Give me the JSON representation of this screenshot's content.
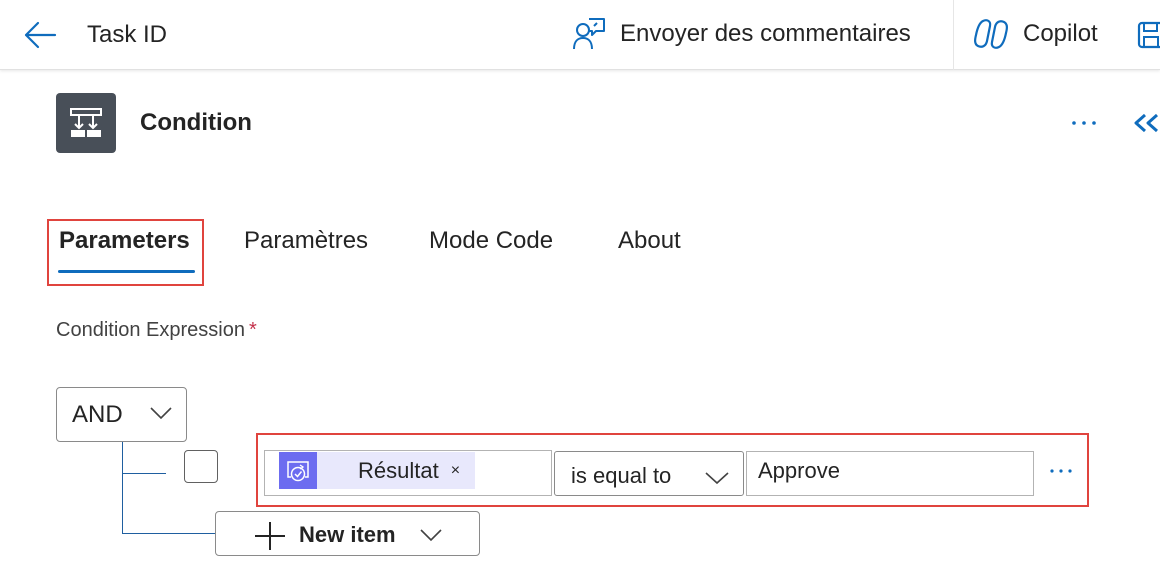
{
  "header": {
    "title": "Task ID",
    "back_icon": "arrow-left-icon",
    "feedback_label": "Envoyer des commentaires",
    "feedback_icon": "person-feedback-icon",
    "copilot_label": "Copilot",
    "copilot_icon": "copilot-icon",
    "save_icon": "save-icon"
  },
  "action": {
    "title": "Condition",
    "icon": "condition-icon",
    "more_icon": "more-horizontal-icon",
    "collapse_icon": "chevron-double-left-icon"
  },
  "tabs": [
    {
      "label": "Parameters",
      "active": true
    },
    {
      "label": "Paramètres",
      "active": false
    },
    {
      "label": "Mode Code",
      "active": false
    },
    {
      "label": "About",
      "active": false
    }
  ],
  "condition": {
    "label": "Condition Expression",
    "required_mark": "*",
    "group_operator": "AND",
    "rows": [
      {
        "checked": false,
        "token_label": "Résultat",
        "token_remove": "×",
        "token_icon": "approval-icon",
        "operator": "is equal to",
        "value": "Approve"
      }
    ],
    "new_item_label": "New item"
  },
  "colors": {
    "accent": "#0f6cbd",
    "highlight": "#e0443e",
    "token_bg": "#e8e8fc",
    "token_icon_bg": "#6c6cf0",
    "action_icon_bg": "#484f58",
    "required": "#c4314b"
  }
}
